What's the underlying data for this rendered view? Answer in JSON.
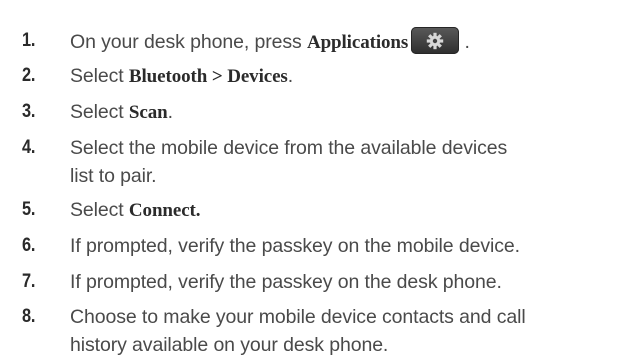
{
  "steps": [
    {
      "number": "1.",
      "text": "On your desk phone, press ",
      "bold": "Applications",
      "after": " .",
      "icon": "gear-icon"
    },
    {
      "number": "2.",
      "text": "Select ",
      "bold": "Bluetooth > Devices",
      "after": "."
    },
    {
      "number": "3.",
      "text": "Select ",
      "bold": "Scan",
      "after": "."
    },
    {
      "number": "4.",
      "line1": "Select the mobile device from the available devices",
      "line2": "list to pair."
    },
    {
      "number": "5.",
      "text": "Select ",
      "bold": "Connect."
    },
    {
      "number": "6.",
      "text": "If prompted, verify the passkey on the mobile device."
    },
    {
      "number": "7.",
      "text": "If prompted, verify the passkey on the desk phone."
    },
    {
      "number": "8.",
      "line1": "Choose to make your mobile device contacts and call",
      "line2": "history available on your desk phone."
    }
  ]
}
